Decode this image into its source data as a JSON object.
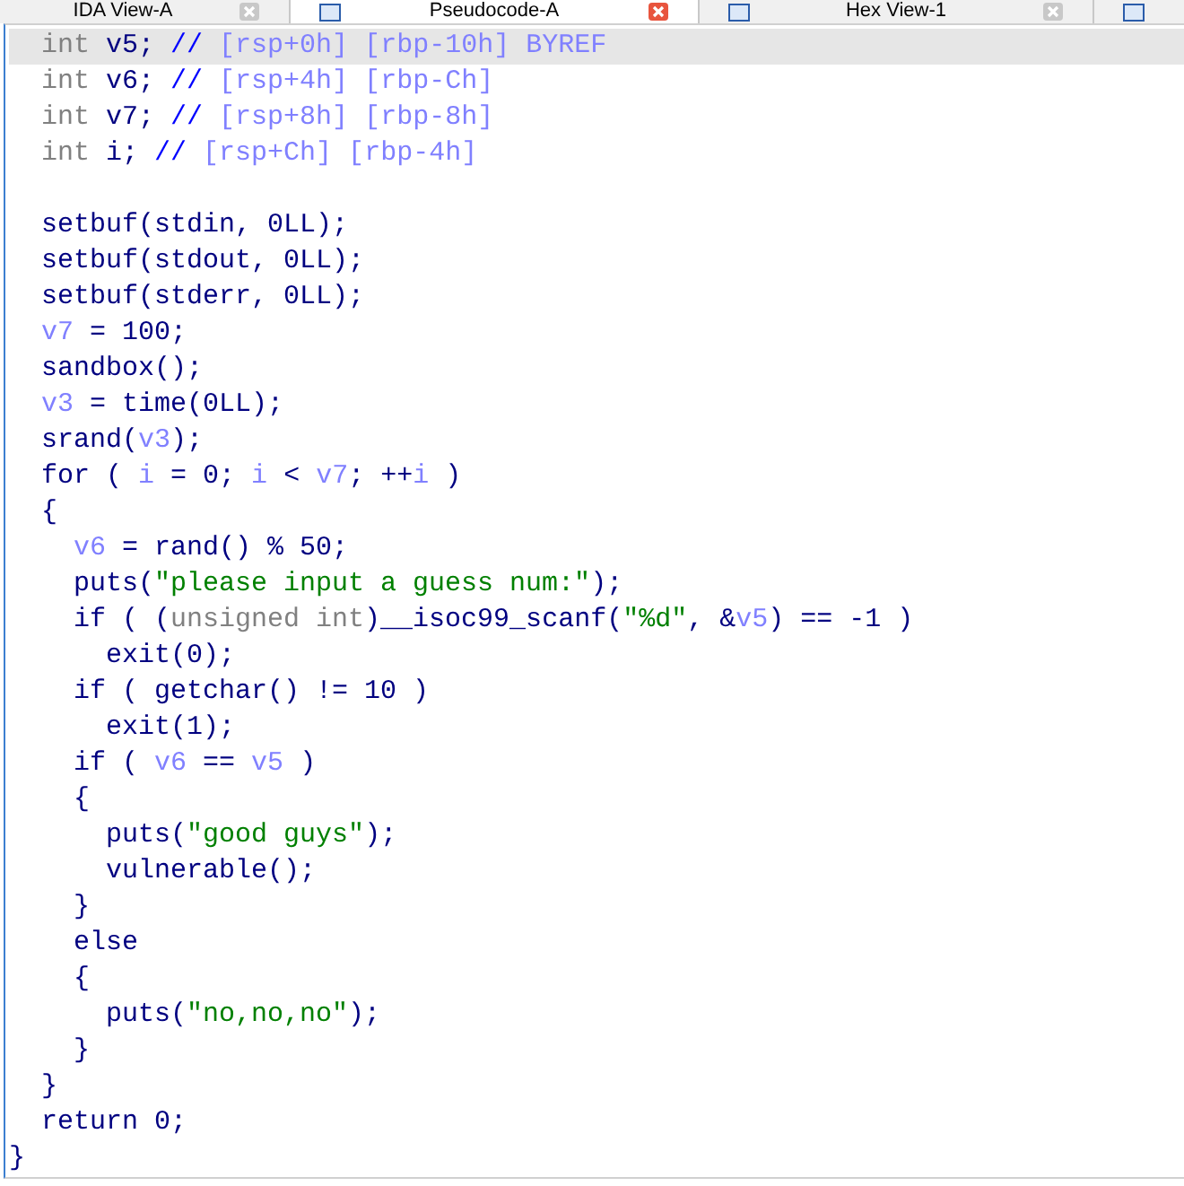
{
  "tabs": [
    {
      "label": "IDA View-A",
      "selected": false,
      "icon": false
    },
    {
      "label": "Pseudocode-A",
      "selected": true,
      "icon": true
    },
    {
      "label": "Hex View-1",
      "selected": false,
      "icon": true
    }
  ],
  "code_lines": [
    {
      "selected": true,
      "tokens": [
        {
          "kind": "type",
          "text": "  int"
        },
        {
          "kind": "code",
          "text": " v5; "
        },
        {
          "kind": "comment",
          "text": "//"
        },
        {
          "kind": "var",
          "text": " [rsp+0h] [rbp-10h] BYREF"
        }
      ]
    },
    {
      "selected": false,
      "tokens": [
        {
          "kind": "type",
          "text": "  int"
        },
        {
          "kind": "code",
          "text": " v6; "
        },
        {
          "kind": "comment",
          "text": "//"
        },
        {
          "kind": "var",
          "text": " [rsp+4h] [rbp-Ch]"
        }
      ]
    },
    {
      "selected": false,
      "tokens": [
        {
          "kind": "type",
          "text": "  int"
        },
        {
          "kind": "code",
          "text": " v7; "
        },
        {
          "kind": "comment",
          "text": "//"
        },
        {
          "kind": "var",
          "text": " [rsp+8h] [rbp-8h]"
        }
      ]
    },
    {
      "selected": false,
      "tokens": [
        {
          "kind": "type",
          "text": "  int"
        },
        {
          "kind": "code",
          "text": " i; "
        },
        {
          "kind": "comment",
          "text": "//"
        },
        {
          "kind": "var",
          "text": " [rsp+Ch] [rbp-4h]"
        }
      ]
    },
    {
      "selected": false
    },
    {
      "selected": false,
      "tokens": [
        {
          "kind": "code",
          "text": "  setbuf(stdin, 0LL);"
        }
      ]
    },
    {
      "selected": false,
      "tokens": [
        {
          "kind": "code",
          "text": "  setbuf(stdout, 0LL);"
        }
      ]
    },
    {
      "selected": false,
      "tokens": [
        {
          "kind": "code",
          "text": "  setbuf(stderr, 0LL);"
        }
      ]
    },
    {
      "selected": false,
      "tokens": [
        {
          "kind": "var",
          "text": "  v7"
        },
        {
          "kind": "code",
          "text": " = 100;"
        }
      ]
    },
    {
      "selected": false,
      "tokens": [
        {
          "kind": "code",
          "text": "  sandbox();"
        }
      ]
    },
    {
      "selected": false,
      "tokens": [
        {
          "kind": "var",
          "text": "  v3"
        },
        {
          "kind": "code",
          "text": " = time(0LL);"
        }
      ]
    },
    {
      "selected": false,
      "tokens": [
        {
          "kind": "code",
          "text": "  srand("
        },
        {
          "kind": "var",
          "text": "v3"
        },
        {
          "kind": "code",
          "text": ");"
        }
      ]
    },
    {
      "selected": false,
      "tokens": [
        {
          "kind": "code",
          "text": "  for ( "
        },
        {
          "kind": "var",
          "text": "i"
        },
        {
          "kind": "code",
          "text": " = 0; "
        },
        {
          "kind": "var",
          "text": "i"
        },
        {
          "kind": "code",
          "text": " < "
        },
        {
          "kind": "var",
          "text": "v7"
        },
        {
          "kind": "code",
          "text": "; ++"
        },
        {
          "kind": "var",
          "text": "i"
        },
        {
          "kind": "code",
          "text": " )"
        }
      ]
    },
    {
      "selected": false,
      "tokens": [
        {
          "kind": "code",
          "text": "  {"
        }
      ]
    },
    {
      "selected": false,
      "tokens": [
        {
          "kind": "var",
          "text": "    v6"
        },
        {
          "kind": "code",
          "text": " = rand() % 50;"
        }
      ]
    },
    {
      "selected": false,
      "tokens": [
        {
          "kind": "code",
          "text": "    puts("
        },
        {
          "kind": "str",
          "text": "\"please input a guess num:\""
        },
        {
          "kind": "code",
          "text": ");"
        }
      ]
    },
    {
      "selected": false,
      "tokens": [
        {
          "kind": "code",
          "text": "    if ( ("
        },
        {
          "kind": "type",
          "text": "unsigned int"
        },
        {
          "kind": "code",
          "text": ")__isoc99_scanf("
        },
        {
          "kind": "str",
          "text": "\"%d\""
        },
        {
          "kind": "code",
          "text": ", &"
        },
        {
          "kind": "var",
          "text": "v5"
        },
        {
          "kind": "code",
          "text": ") == -1 )"
        }
      ]
    },
    {
      "selected": false,
      "tokens": [
        {
          "kind": "code",
          "text": "      exit(0);"
        }
      ]
    },
    {
      "selected": false,
      "tokens": [
        {
          "kind": "code",
          "text": "    if ( getchar() != 10 )"
        }
      ]
    },
    {
      "selected": false,
      "tokens": [
        {
          "kind": "code",
          "text": "      exit(1);"
        }
      ]
    },
    {
      "selected": false,
      "tokens": [
        {
          "kind": "code",
          "text": "    if ( "
        },
        {
          "kind": "var",
          "text": "v6"
        },
        {
          "kind": "code",
          "text": " == "
        },
        {
          "kind": "var",
          "text": "v5"
        },
        {
          "kind": "code",
          "text": " )"
        }
      ]
    },
    {
      "selected": false,
      "tokens": [
        {
          "kind": "code",
          "text": "    {"
        }
      ]
    },
    {
      "selected": false,
      "tokens": [
        {
          "kind": "code",
          "text": "      puts("
        },
        {
          "kind": "str",
          "text": "\"good guys\""
        },
        {
          "kind": "code",
          "text": ");"
        }
      ]
    },
    {
      "selected": false,
      "tokens": [
        {
          "kind": "code",
          "text": "      vulnerable();"
        }
      ]
    },
    {
      "selected": false,
      "tokens": [
        {
          "kind": "code",
          "text": "    }"
        }
      ]
    },
    {
      "selected": false,
      "tokens": [
        {
          "kind": "code",
          "text": "    else"
        }
      ]
    },
    {
      "selected": false,
      "tokens": [
        {
          "kind": "code",
          "text": "    {"
        }
      ]
    },
    {
      "selected": false,
      "tokens": [
        {
          "kind": "code",
          "text": "      puts("
        },
        {
          "kind": "str",
          "text": "\"no,no,no\""
        },
        {
          "kind": "code",
          "text": ");"
        }
      ]
    },
    {
      "selected": false,
      "tokens": [
        {
          "kind": "code",
          "text": "    }"
        }
      ]
    },
    {
      "selected": false,
      "tokens": [
        {
          "kind": "code",
          "text": "  }"
        }
      ]
    },
    {
      "selected": false,
      "tokens": [
        {
          "kind": "code",
          "text": "  return 0;"
        }
      ]
    },
    {
      "selected": false,
      "tokens": [
        {
          "kind": "code",
          "text": "}"
        }
      ]
    }
  ]
}
